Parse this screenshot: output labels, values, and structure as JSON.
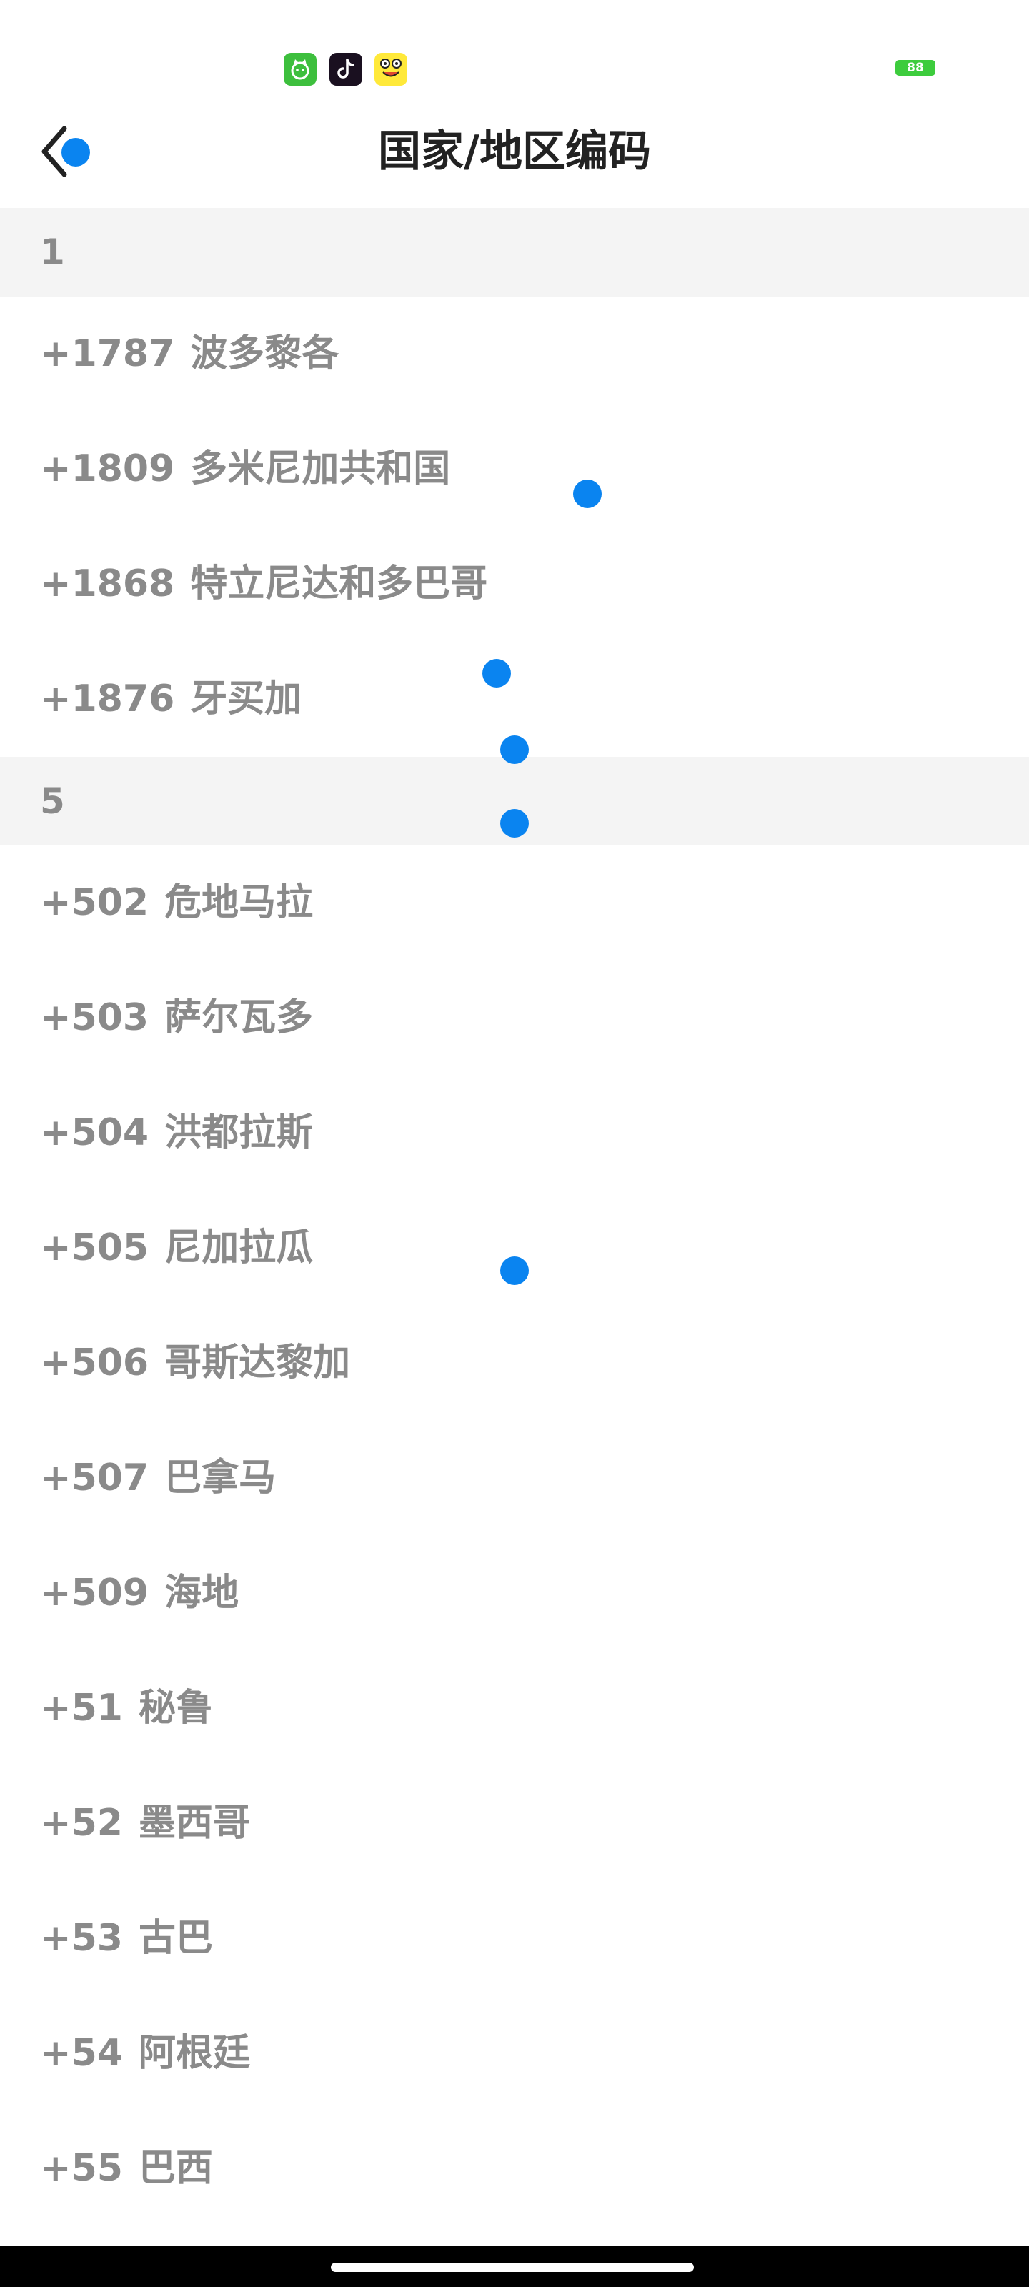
{
  "status_bar": {
    "notification_icons": [
      "cat-app-icon",
      "tiktok-icon",
      "frog-app-icon"
    ],
    "battery_level": "88"
  },
  "header": {
    "title": "国家/地区编码",
    "back_icon": "chevron-left-icon"
  },
  "sections": [
    {
      "label": "1",
      "items": [
        {
          "code": "+1787",
          "name": "波多黎各"
        },
        {
          "code": "+1809",
          "name": "多米尼加共和国"
        },
        {
          "code": "+1868",
          "name": "特立尼达和多巴哥"
        },
        {
          "code": "+1876",
          "name": "牙买加"
        }
      ]
    },
    {
      "label": "5",
      "items": [
        {
          "code": "+502",
          "name": "危地马拉"
        },
        {
          "code": "+503",
          "name": "萨尔瓦多"
        },
        {
          "code": "+504",
          "name": "洪都拉斯"
        },
        {
          "code": "+505",
          "name": "尼加拉瓜"
        },
        {
          "code": "+506",
          "name": "哥斯达黎加"
        },
        {
          "code": "+507",
          "name": "巴拿马"
        },
        {
          "code": "+509",
          "name": "海地"
        },
        {
          "code": "+51",
          "name": "秘鲁"
        },
        {
          "code": "+52",
          "name": "墨西哥"
        },
        {
          "code": "+53",
          "name": "古巴"
        },
        {
          "code": "+54",
          "name": "阿根廷"
        },
        {
          "code": "+55",
          "name": "巴西"
        }
      ]
    }
  ],
  "colors": {
    "accent": "#0a84f0",
    "item_text": "#8a8a8a",
    "title_text": "#222222",
    "section_bg": "#f4f4f4",
    "battery": "#3dcc3d"
  }
}
